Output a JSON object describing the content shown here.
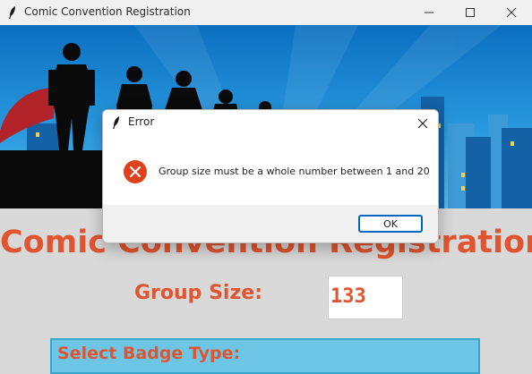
{
  "window": {
    "title": "Comic Convention Registration",
    "controls": [
      "minimize-icon",
      "maximize-icon",
      "close-icon"
    ]
  },
  "banner": {
    "description_icon": "superhero-silhouettes-banner"
  },
  "form": {
    "heading": "Comic Convention Registration",
    "group_size_label": "Group Size:",
    "group_size_value": "133",
    "badge_type_label": "Select Badge Type:"
  },
  "dialog": {
    "title": "Error",
    "message": "Group size must be a whole number between 1 and 20",
    "ok_label": "OK",
    "icon": "error-icon"
  },
  "colors": {
    "accent_orange": "#e0552f",
    "sky_blue": "#1e8fd6",
    "panel_gray": "#d9d9d9",
    "badge_frame": "#6ec6e6",
    "error_red": "#e0401c",
    "button_border": "#0067c0"
  }
}
